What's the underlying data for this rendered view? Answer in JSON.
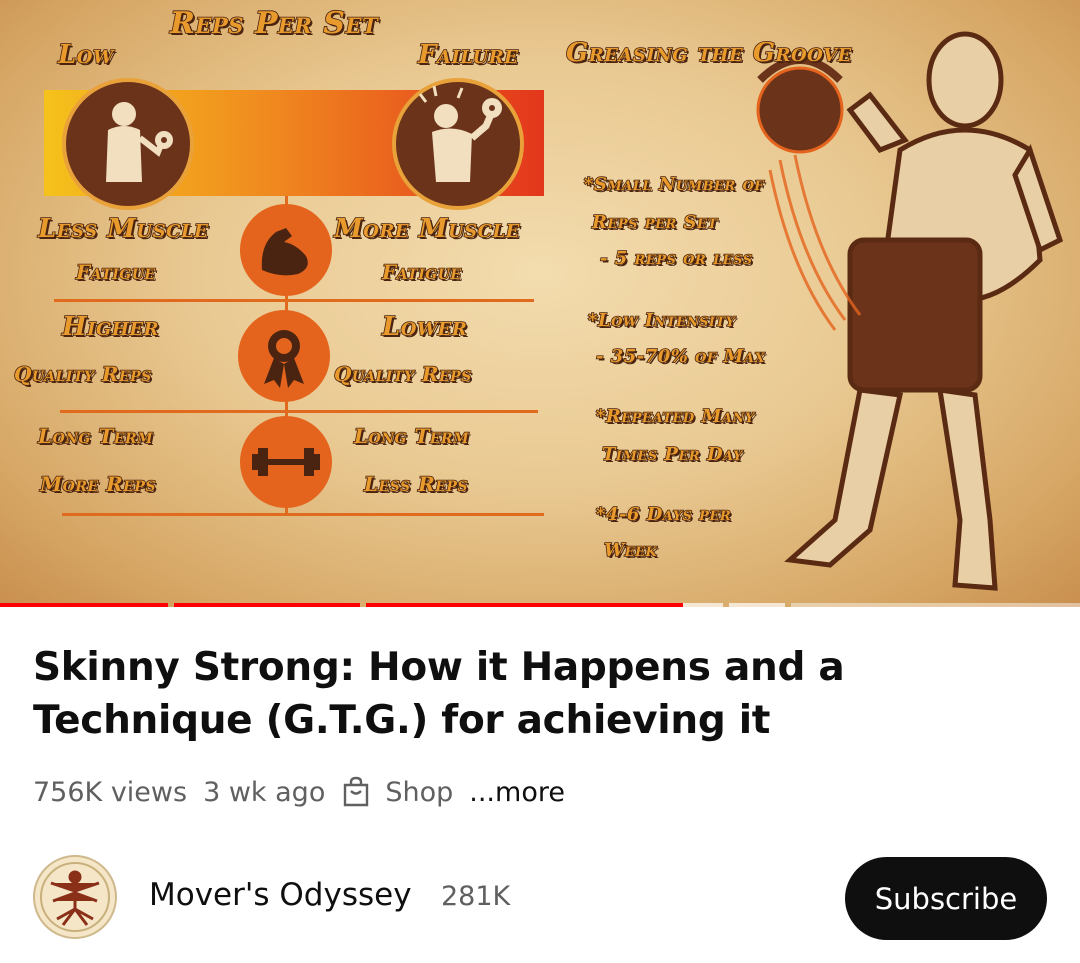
{
  "thumbnail": {
    "header": "Reps Per Set",
    "low": "Low",
    "failure": "Failure",
    "gtg_title": "Greasing the Groove",
    "rows": [
      {
        "left_1": "Less Muscle",
        "left_2": "Fatigue",
        "right_1": "More Muscle",
        "right_2": "Fatigue",
        "icon": "flexed-arm-icon"
      },
      {
        "left_1": "Higher",
        "left_2": "Quality Reps",
        "right_1": "Lower",
        "right_2": "Quality Reps",
        "icon": "award-ribbon-icon"
      },
      {
        "left_1": "Long Term",
        "left_2": "More Reps",
        "right_1": "Long Term",
        "right_2": "Less Reps",
        "icon": "dumbbell-icon"
      }
    ],
    "bullets": [
      [
        "*Small Number of",
        "Reps per Set",
        "- 5 reps or less"
      ],
      [
        "*Low Intensity",
        "- 35-70% of Max"
      ],
      [
        "*Repeated Many",
        "Times Per Day"
      ],
      [
        "*4-6 Days per",
        "Week"
      ]
    ],
    "colors": {
      "orange": "#e4641d",
      "brown": "#6b331a",
      "gold": "#e89a2c",
      "progress_red": "#ff0000"
    },
    "progress_fraction": 0.63
  },
  "video": {
    "title": "Skinny Strong: How it Happens and a Technique (G.T.G.) for achieving it",
    "views": "756K views",
    "age": "3 wk ago",
    "shop_label": "Shop",
    "more_label": "...more"
  },
  "channel": {
    "name": "Mover's Odyssey",
    "subscribers": "281K",
    "subscribe_label": "Subscribe"
  }
}
